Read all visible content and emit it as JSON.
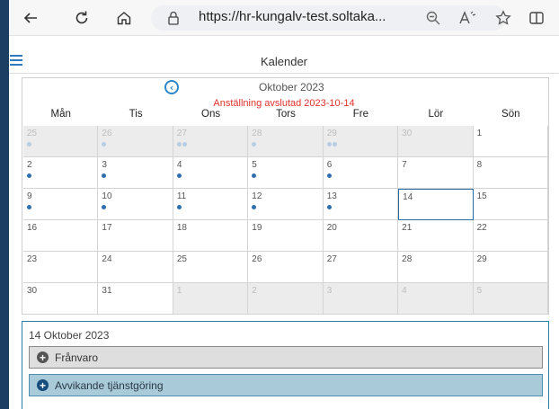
{
  "browser": {
    "url": "https://hr-kungalv-test.soltaka...",
    "icons": [
      "back-arrow-icon",
      "refresh-icon",
      "home-icon",
      "lock-icon",
      "zoom-icon",
      "read-aloud-icon",
      "favorite-star-icon",
      "split-screen-icon"
    ]
  },
  "app": {
    "title": "Kalender"
  },
  "calendar": {
    "month_title": "Oktober 2023",
    "employment_ended": "Anställning avslutad 2023-10-14",
    "weekdays": [
      "Mån",
      "Tis",
      "Ons",
      "Tors",
      "Fre",
      "Lör",
      "Sön"
    ],
    "weeks": [
      [
        {
          "d": "25",
          "o": true,
          "n": 1
        },
        {
          "d": "26",
          "o": true,
          "n": 1
        },
        {
          "d": "27",
          "o": true,
          "n": 2
        },
        {
          "d": "28",
          "o": true,
          "n": 1
        },
        {
          "d": "29",
          "o": true,
          "n": 2
        },
        {
          "d": "30",
          "o": true,
          "n": 0
        },
        {
          "d": "1",
          "o": false,
          "n": 0
        }
      ],
      [
        {
          "d": "2",
          "o": false,
          "n": 1
        },
        {
          "d": "3",
          "o": false,
          "n": 1
        },
        {
          "d": "4",
          "o": false,
          "n": 1
        },
        {
          "d": "5",
          "o": false,
          "n": 1
        },
        {
          "d": "6",
          "o": false,
          "n": 1
        },
        {
          "d": "7",
          "o": false,
          "n": 0
        },
        {
          "d": "8",
          "o": false,
          "n": 0
        }
      ],
      [
        {
          "d": "9",
          "o": false,
          "n": 1
        },
        {
          "d": "10",
          "o": false,
          "n": 1
        },
        {
          "d": "11",
          "o": false,
          "n": 1
        },
        {
          "d": "12",
          "o": false,
          "n": 1
        },
        {
          "d": "13",
          "o": false,
          "n": 1
        },
        {
          "d": "14",
          "o": false,
          "n": 0,
          "sel": true
        },
        {
          "d": "15",
          "o": false,
          "n": 0
        }
      ],
      [
        {
          "d": "16",
          "o": false,
          "n": 0
        },
        {
          "d": "17",
          "o": false,
          "n": 0
        },
        {
          "d": "18",
          "o": false,
          "n": 0
        },
        {
          "d": "19",
          "o": false,
          "n": 0
        },
        {
          "d": "20",
          "o": false,
          "n": 0
        },
        {
          "d": "21",
          "o": false,
          "n": 0
        },
        {
          "d": "22",
          "o": false,
          "n": 0
        }
      ],
      [
        {
          "d": "23",
          "o": false,
          "n": 0
        },
        {
          "d": "24",
          "o": false,
          "n": 0
        },
        {
          "d": "25",
          "o": false,
          "n": 0
        },
        {
          "d": "26",
          "o": false,
          "n": 0
        },
        {
          "d": "27",
          "o": false,
          "n": 0
        },
        {
          "d": "28",
          "o": false,
          "n": 0
        },
        {
          "d": "29",
          "o": false,
          "n": 0
        }
      ],
      [
        {
          "d": "30",
          "o": false,
          "n": 0
        },
        {
          "d": "31",
          "o": false,
          "n": 0
        },
        {
          "d": "1",
          "o": true,
          "n": 0
        },
        {
          "d": "2",
          "o": true,
          "n": 0
        },
        {
          "d": "3",
          "o": true,
          "n": 0
        },
        {
          "d": "4",
          "o": true,
          "n": 0
        },
        {
          "d": "5",
          "o": true,
          "n": 0
        }
      ]
    ]
  },
  "day_detail": {
    "title": "14 Oktober 2023",
    "sections": [
      {
        "label": "Frånvaro",
        "color": "#dedede"
      },
      {
        "label": "Avvikande tjänstgöring",
        "color": "#a8cad9"
      }
    ]
  }
}
